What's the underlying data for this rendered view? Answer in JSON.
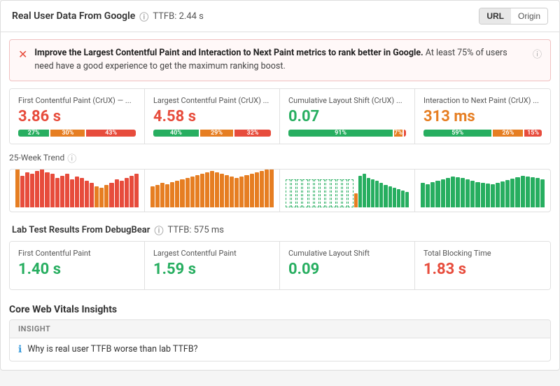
{
  "header": {
    "title": "Real User Data From Google",
    "ttfb": "TTFB: 2.44 s",
    "tab_url": "URL",
    "tab_origin": "Origin"
  },
  "alert": {
    "text_bold": "Improve the Largest Contentful Paint and Interaction to Next Paint metrics to rank better in Google.",
    "text_rest": " At least 75% of users need have a good experience to get the maximum ranking boost."
  },
  "crux_metrics": [
    {
      "label": "First Contentful Paint (CrUX) — ...",
      "value": "3.86 s",
      "color": "red",
      "bars": [
        {
          "pct": "27%",
          "type": "green"
        },
        {
          "pct": "30%",
          "type": "orange"
        },
        {
          "pct": "43%",
          "type": "red"
        }
      ]
    },
    {
      "label": "Largest Contentful Paint (CrUX) ...",
      "value": "4.58 s",
      "color": "red",
      "bars": [
        {
          "pct": "40%",
          "type": "green"
        },
        {
          "pct": "29%",
          "type": "orange"
        },
        {
          "pct": "32%",
          "type": "red"
        }
      ]
    },
    {
      "label": "Cumulative Layout Shift (CrUX) ...",
      "value": "0.07",
      "color": "green",
      "bars": [
        {
          "pct": "91%",
          "type": "green"
        },
        {
          "pct": "7%",
          "type": "orange"
        },
        {
          "pct": "2%",
          "type": "red"
        }
      ]
    },
    {
      "label": "Interaction to Next Paint (CrUX) ...",
      "value": "313 ms",
      "color": "orange",
      "bars": [
        {
          "pct": "59%",
          "type": "green"
        },
        {
          "pct": "26%",
          "type": "orange"
        },
        {
          "pct": "15%",
          "type": "red"
        }
      ]
    }
  ],
  "trend_label": "25-Week Trend",
  "lab_header": {
    "title": "Lab Test Results From DebugBear",
    "ttfb": "TTFB: 575 ms"
  },
  "lab_metrics": [
    {
      "label": "First Contentful Paint",
      "value": "1.40 s",
      "color": "green"
    },
    {
      "label": "Largest Contentful Paint",
      "value": "1.59 s",
      "color": "green"
    },
    {
      "label": "Cumulative Layout Shift",
      "value": "0.09",
      "color": "green"
    },
    {
      "label": "Total Blocking Time",
      "value": "1.83 s",
      "color": "red"
    }
  ],
  "cwv_section": {
    "title": "Core Web Vitals Insights",
    "insight_header": "INSIGHT",
    "insights": [
      {
        "text": "Why is real user TTFB worse than lab TTFB?",
        "icon": "info"
      }
    ]
  }
}
